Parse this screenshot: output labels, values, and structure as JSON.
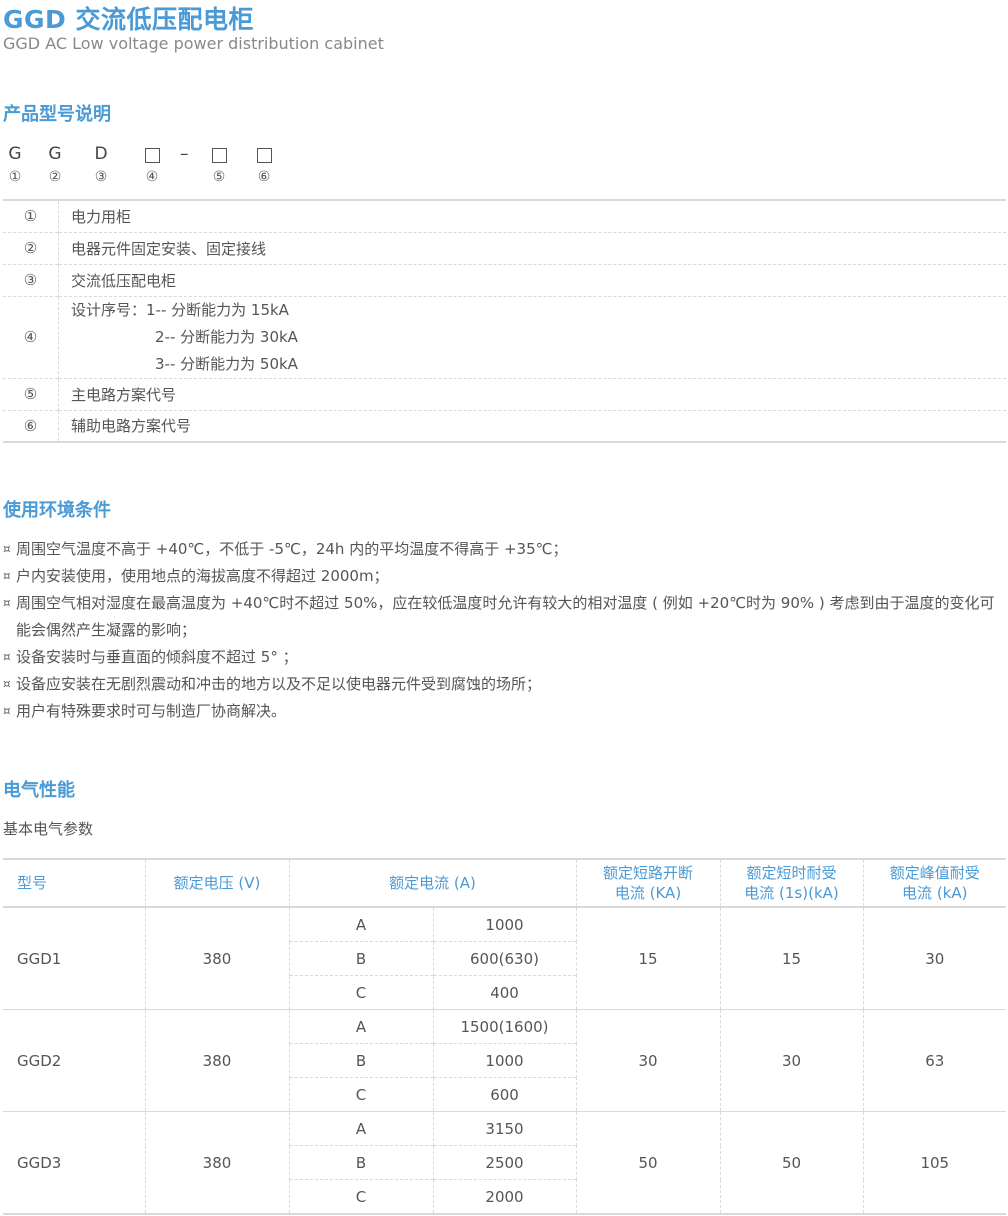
{
  "header": {
    "title": "GGD 交流低压配电柜",
    "subtitle": "GGD AC Low voltage power distribution cabinet"
  },
  "sections": {
    "model": "产品型号说明",
    "environment": "使用环境条件",
    "electrical": "电气性能"
  },
  "model_code": {
    "chars": [
      "G",
      "G",
      "D"
    ],
    "dash": "–",
    "numbers": [
      "①",
      "②",
      "③",
      "④",
      "⑤",
      "⑥"
    ]
  },
  "explanations": [
    {
      "num": "①",
      "lines": [
        "电力用柜"
      ]
    },
    {
      "num": "②",
      "lines": [
        "电器元件固定安装、固定接线"
      ]
    },
    {
      "num": "③",
      "lines": [
        "交流低压配电柜"
      ]
    },
    {
      "num": "④",
      "lines": [
        "设计序号：1-- 分断能力为 15kA",
        "2-- 分断能力为 30kA",
        "3-- 分断能力为 50kA"
      ]
    },
    {
      "num": "⑤",
      "lines": [
        "主电路方案代号"
      ]
    },
    {
      "num": "⑥",
      "lines": [
        "辅助电路方案代号"
      ]
    }
  ],
  "conditions": {
    "bullet": "¤",
    "items": [
      "周围空气温度不高于 +40℃，不低于 -5℃，24h 内的平均温度不得高于 +35℃；",
      "户内安装使用，使用地点的海拔高度不得超过 2000m；",
      "周围空气相对湿度在最高温度为 +40℃时不超过 50%，应在较低温度时允许有较大的相对温度 ( 例如 +20℃时为 90% ) 考虑到由于温度的变化可能会偶然产生凝露的影响；",
      "设备安装时与垂直面的倾斜度不超过 5° ；",
      "设备应安装在无剧烈震动和冲击的地方以及不足以使电器元件受到腐蚀的场所；",
      "用户有特殊要求时可与制造厂协商解决。"
    ]
  },
  "electrical": {
    "intro": "基本电气参数",
    "headers": {
      "model": "型号",
      "voltage": "额定电压 (V)",
      "current": "额定电流 (A)",
      "short_break_1": "额定短路开断",
      "short_break_2": "电流 (KA)",
      "short_time_1": "额定短时耐受",
      "short_time_2": "电流 (1s)(kA)",
      "peak_1": "额定峰值耐受",
      "peak_2": "电流 (kA)"
    },
    "rows": [
      {
        "model": "GGD1",
        "voltage": "380",
        "currents": [
          {
            "grade": "A",
            "value": "1000"
          },
          {
            "grade": "B",
            "value": "600(630)"
          },
          {
            "grade": "C",
            "value": "400"
          }
        ],
        "short_break": "15",
        "short_time": "15",
        "peak": "30"
      },
      {
        "model": "GGD2",
        "voltage": "380",
        "currents": [
          {
            "grade": "A",
            "value": "1500(1600)"
          },
          {
            "grade": "B",
            "value": "1000"
          },
          {
            "grade": "C",
            "value": "600"
          }
        ],
        "short_break": "30",
        "short_time": "30",
        "peak": "63"
      },
      {
        "model": "GGD3",
        "voltage": "380",
        "currents": [
          {
            "grade": "A",
            "value": "3150"
          },
          {
            "grade": "B",
            "value": "2500"
          },
          {
            "grade": "C",
            "value": "2000"
          }
        ],
        "short_break": "50",
        "short_time": "50",
        "peak": "105"
      }
    ]
  }
}
